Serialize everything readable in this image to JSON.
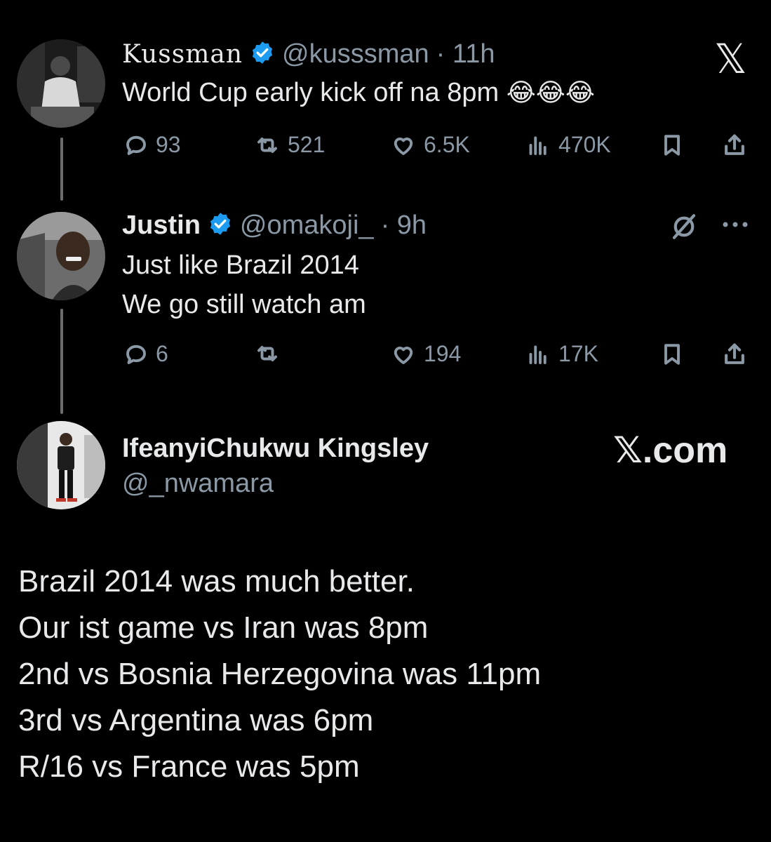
{
  "tweet1": {
    "display_name": "Kussman",
    "handle": "@kusssman",
    "time": "· 11h",
    "text": "World Cup early kick off na 8pm",
    "emoji": "😂😂😂",
    "actions": {
      "replies": "93",
      "reposts": "521",
      "likes": "6.5K",
      "views": "470K"
    },
    "logo_glyph": "𝕏"
  },
  "tweet2": {
    "display_name": "Justin",
    "handle": "@omakoji_",
    "time": "· 9h",
    "text_line1": "Just like Brazil 2014",
    "text_line2": "We go still watch am",
    "actions": {
      "replies": "6",
      "reposts": "",
      "likes": "194",
      "views": "17K"
    }
  },
  "tweet3": {
    "display_name": "IfeanyiChukwu Kingsley",
    "handle": "@_nwamara",
    "brand": "𝕏.com",
    "lines": [
      "Brazil 2014 was much better.",
      "Our ist game vs Iran was 8pm",
      "2nd vs Bosnia Herzegovina was 11pm",
      "3rd vs Argentina was 6pm",
      "R/16 vs France was 5pm"
    ]
  },
  "colors": {
    "background": "#000000",
    "text": "#e7e9ea",
    "muted": "#8b98a5",
    "verified": "#1d9bf0",
    "thread_line": "#6b6b6b"
  }
}
